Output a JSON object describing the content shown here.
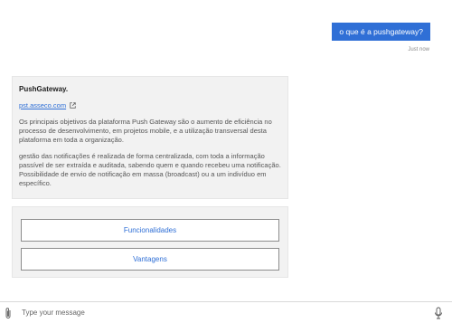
{
  "conversation": {
    "user_message": "o que é a pushgateway?",
    "timestamp": "Just now",
    "bot_card": {
      "title": "PushGateway.",
      "link": "pst.asseco.com",
      "link_icon": "external-link-icon",
      "paragraphs": [
        "Os principais objetivos da plataforma Push Gateway são o aumento de eficiência no processo de desenvolvimento, em projetos mobile, e a utilização transversal desta plataforma em toda a organização.",
        "gestão das notificações é realizada de forma centralizada, com toda a informação passível de ser extraída e auditada, sabendo quem e quando recebeu uma notificação. Possibilidade de envio de notificação em massa (broadcast) ou a um indivíduo em específico."
      ]
    },
    "actions": [
      {
        "label": "Funcionalidades"
      },
      {
        "label": "Vantagens"
      }
    ]
  },
  "composer": {
    "placeholder": "Type your message",
    "attach_icon": "paperclip-icon",
    "mic_icon": "microphone-icon"
  },
  "colors": {
    "accent": "#2f6fd6",
    "card_bg": "#f2f2f2"
  }
}
